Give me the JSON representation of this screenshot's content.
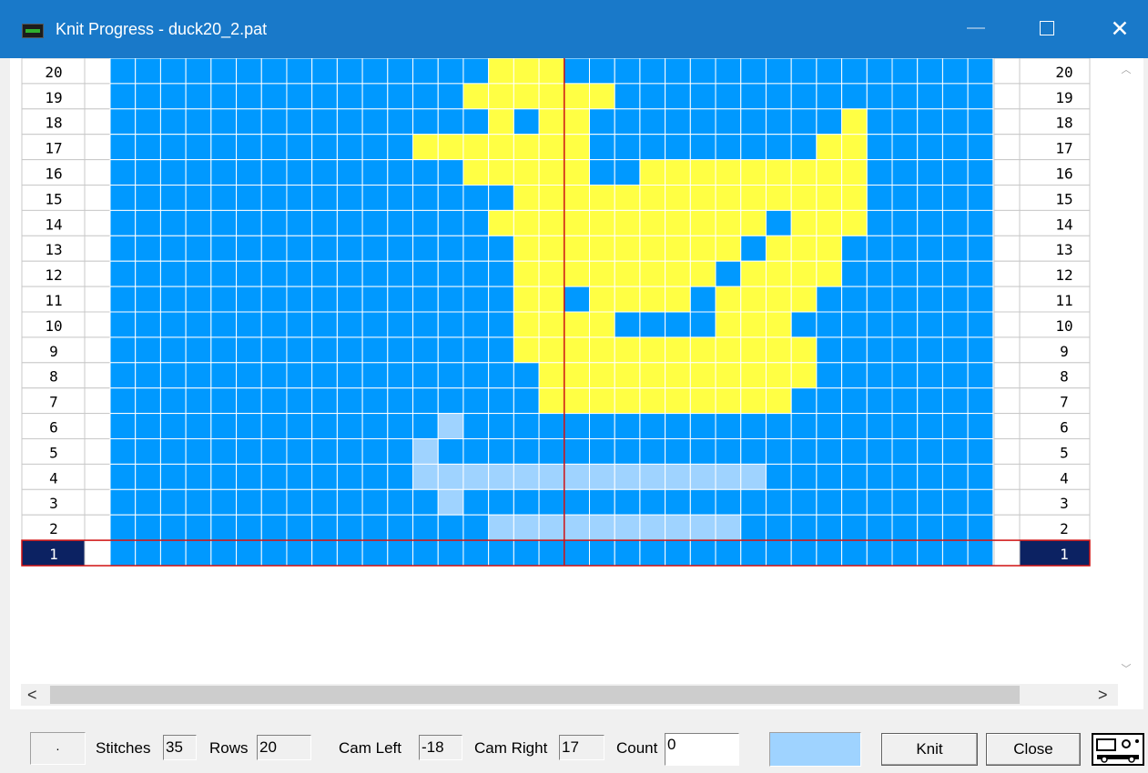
{
  "window": {
    "title": "Knit Progress - duck20_2.pat"
  },
  "pattern": {
    "rows": 20,
    "stitches": 35,
    "current_row": 1,
    "colors": {
      "background": "#0099ff",
      "duck": "#ffff44",
      "water": "#9fd3ff",
      "row_highlight": "#0c2262",
      "center_line": "#d01010",
      "grid": "#ffffff"
    },
    "grid": [
      "00000000000000000000000000000000000",
      "00000000000000022222222220000000000",
      "00000000000002000000000000000000000",
      "00000000000022222222222222000000000",
      "00000000000020000000000000000000000",
      "00000000000002000000000000000000000",
      "00000000000000000111111111100000000",
      "00000000000000000111111111110000000",
      "00000000000000001111111111110000000",
      "00000000000000001111000011100000000",
      "00000000000000001101111011110000000",
      "00000000000000001111111101111000000",
      "00000000000000001111111110111000000",
      "00000000000000011111111111011100000",
      "00000000000000001111111111111100000",
      "00000000000000111110011111111100000",
      "00000000000011111110000000001100000",
      "00000000000000010110000000000100000",
      "00000000000000111111000000000000000",
      "00000000000000011100000000000000000"
    ]
  },
  "status_bar": {
    "indicator": "·",
    "stitches_label": "Stitches",
    "stitches_value": "35",
    "rows_label": "Rows",
    "rows_value": "20",
    "cam_left_label": "Cam Left",
    "cam_left_value": "-18",
    "cam_right_label": "Cam Right",
    "cam_right_value": "17",
    "count_label": "Count",
    "count_value": "0",
    "knit_button": "Knit",
    "close_button": "Close",
    "device_icon": "machine-icon"
  },
  "icons": {
    "app": "knitter-icon",
    "minimize": "minimize-icon",
    "maximize": "maximize-icon",
    "close": "close-icon",
    "scroll_up": "chevron-up-icon",
    "scroll_down": "chevron-down-icon",
    "scroll_left": "chevron-left-icon",
    "scroll_right": "chevron-right-icon"
  }
}
